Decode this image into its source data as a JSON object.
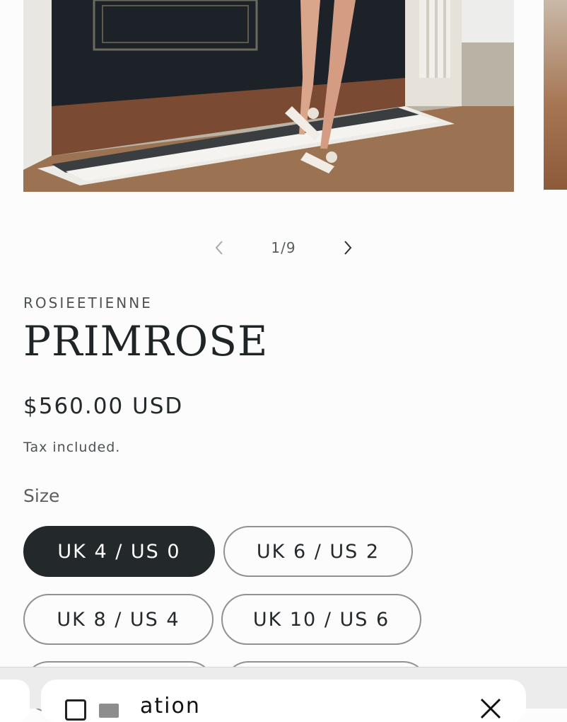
{
  "gallery": {
    "counter": "1/9",
    "prev_icon": "chevron-left-icon",
    "next_icon": "chevron-right-icon"
  },
  "product": {
    "vendor": "ROSIEETIENNE",
    "title": "PRIMROSE",
    "price": "$560.00 USD",
    "tax_note": "Tax included."
  },
  "size": {
    "label": "Size",
    "options": [
      {
        "label": "UK 4 / US 0",
        "selected": true
      },
      {
        "label": "UK 6 / US 2",
        "selected": false
      },
      {
        "label": "UK 8 / US 4",
        "selected": false
      },
      {
        "label": "UK 10 / US 6",
        "selected": false
      }
    ]
  },
  "bottom_sheet": {
    "text": "ation",
    "close_icon": "close-icon"
  },
  "colors": {
    "selected_pill": "#23282a",
    "pill_border": "#8e9294",
    "background": "#fcfcfc"
  }
}
